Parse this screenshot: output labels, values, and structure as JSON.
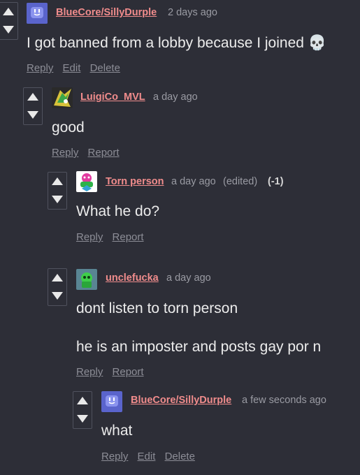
{
  "comments": [
    {
      "username": "BlueCore/SillyDurple",
      "time": "2 days ago",
      "text_lines": [
        "I got banned from a lobby because I joined 💀"
      ],
      "actions": [
        "Reply",
        "Edit",
        "Delete"
      ]
    },
    {
      "username": "LuigiCo_MVL",
      "time": "a day ago",
      "text_lines": [
        "good"
      ],
      "actions": [
        "Reply",
        "Report"
      ]
    },
    {
      "username": "Torn person",
      "time": "a day ago",
      "edited": "(edited)",
      "score": "(-1)",
      "text_lines": [
        "What he do?"
      ],
      "actions": [
        "Reply",
        "Report"
      ]
    },
    {
      "username": "unclefucka",
      "time": "a day ago",
      "text_lines": [
        "dont listen to torn person",
        "he is an imposter and posts gay por n"
      ],
      "actions": [
        "Reply",
        "Report"
      ]
    },
    {
      "username": "BlueCore/SillyDurple",
      "time": "a few seconds ago",
      "text_lines": [
        "what"
      ],
      "actions": [
        "Reply",
        "Edit",
        "Delete"
      ]
    }
  ],
  "icons": {
    "upvote": "upvote-arrow-icon",
    "downvote": "downvote-arrow-icon"
  },
  "colors": {
    "background": "#2d2e37",
    "username": "#f08c8c",
    "muted": "#9a9ba3"
  }
}
